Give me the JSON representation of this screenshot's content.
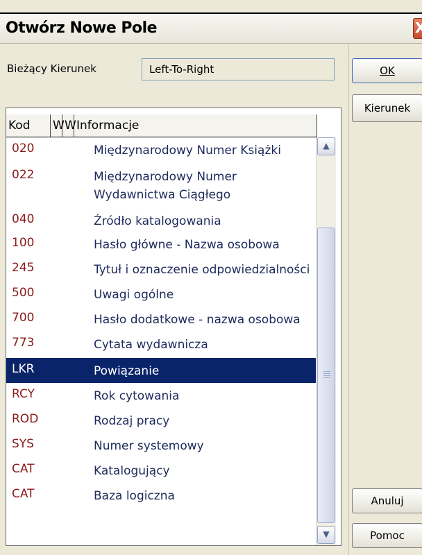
{
  "window": {
    "title": "Otwórz Nowe Pole",
    "close_label": "X"
  },
  "direction": {
    "label": "Bieżący Kierunek",
    "value": "Left-To-Right"
  },
  "buttons": {
    "ok": "OK",
    "kierunek": "Kierunek",
    "anuluj": "Anuluj",
    "pomoc": "Pomoc"
  },
  "list": {
    "headers": {
      "kod": "Kod",
      "w1": "W",
      "w2": "W",
      "info": "Informacje"
    },
    "rows": [
      {
        "code": "020",
        "info": "Międzynarodowy Numer Książki"
      },
      {
        "code": "022",
        "info": "Międzynarodowy Numer\nWydawnictwa Ciągłego"
      },
      {
        "code": "040",
        "info": "Źródło katalogowania"
      },
      {
        "code": "100",
        "info": "Hasło główne - Nazwa osobowa"
      },
      {
        "code": "245",
        "info": "Tytuł i oznaczenie odpowiedzialności"
      },
      {
        "code": "500",
        "info": "Uwagi ogólne"
      },
      {
        "code": "700",
        "info": "Hasło dodatkowe - nazwa osobowa"
      },
      {
        "code": "773",
        "info": "Cytata wydawnicza"
      },
      {
        "code": "LKR",
        "info": "Powiązanie",
        "selected": true
      },
      {
        "code": "RCY",
        "info": "Rok cytowania"
      },
      {
        "code": "ROD",
        "info": "Rodzaj pracy"
      },
      {
        "code": "SYS",
        "info": "Numer systemowy"
      },
      {
        "code": "CAT",
        "info": "Katalogujący"
      },
      {
        "code": "CAT",
        "info": "Baza logiczna"
      }
    ]
  },
  "scrollbar": {
    "up_icon": "▲",
    "down_icon": "▼"
  },
  "colors": {
    "code_text": "#8b1a1a",
    "info_text": "#1d2a5c",
    "selection": "#0a246a"
  }
}
